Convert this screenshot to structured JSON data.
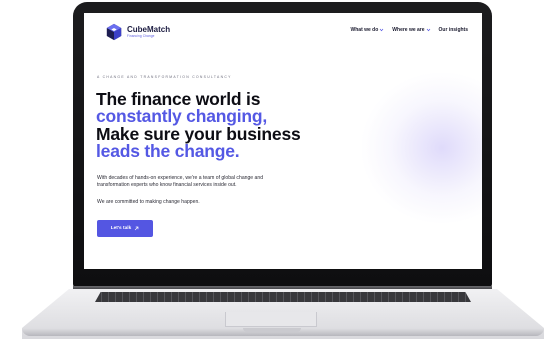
{
  "brand": {
    "name": "CubeMatch",
    "tagline": "Financing Change",
    "primary_color": "#5456e2",
    "dark_color": "#0d0d14"
  },
  "nav": {
    "items": [
      {
        "label": "What we do",
        "dropdown": true
      },
      {
        "label": "Where we are",
        "dropdown": true
      },
      {
        "label": "Our insights",
        "dropdown": false
      }
    ]
  },
  "hero": {
    "eyebrow": "A CHANGE AND TRANSFORMATION CONSULTANCY",
    "headline": {
      "line1": "The finance world is",
      "line2": "constantly changing,",
      "line3": "Make sure your business",
      "line4": "leads the change."
    },
    "description": {
      "line1": "With decades of hands-on experience, we're a team of global change and",
      "line2": "transformation experts who know financial services inside out."
    },
    "commitment": "We are committed to making change happen.",
    "cta_label": "Let's talk"
  },
  "icons": {
    "logo": "cube-logo-icon",
    "nav_chevron": "chevron-down-icon",
    "cta_arrow": "arrow-up-right-icon"
  }
}
